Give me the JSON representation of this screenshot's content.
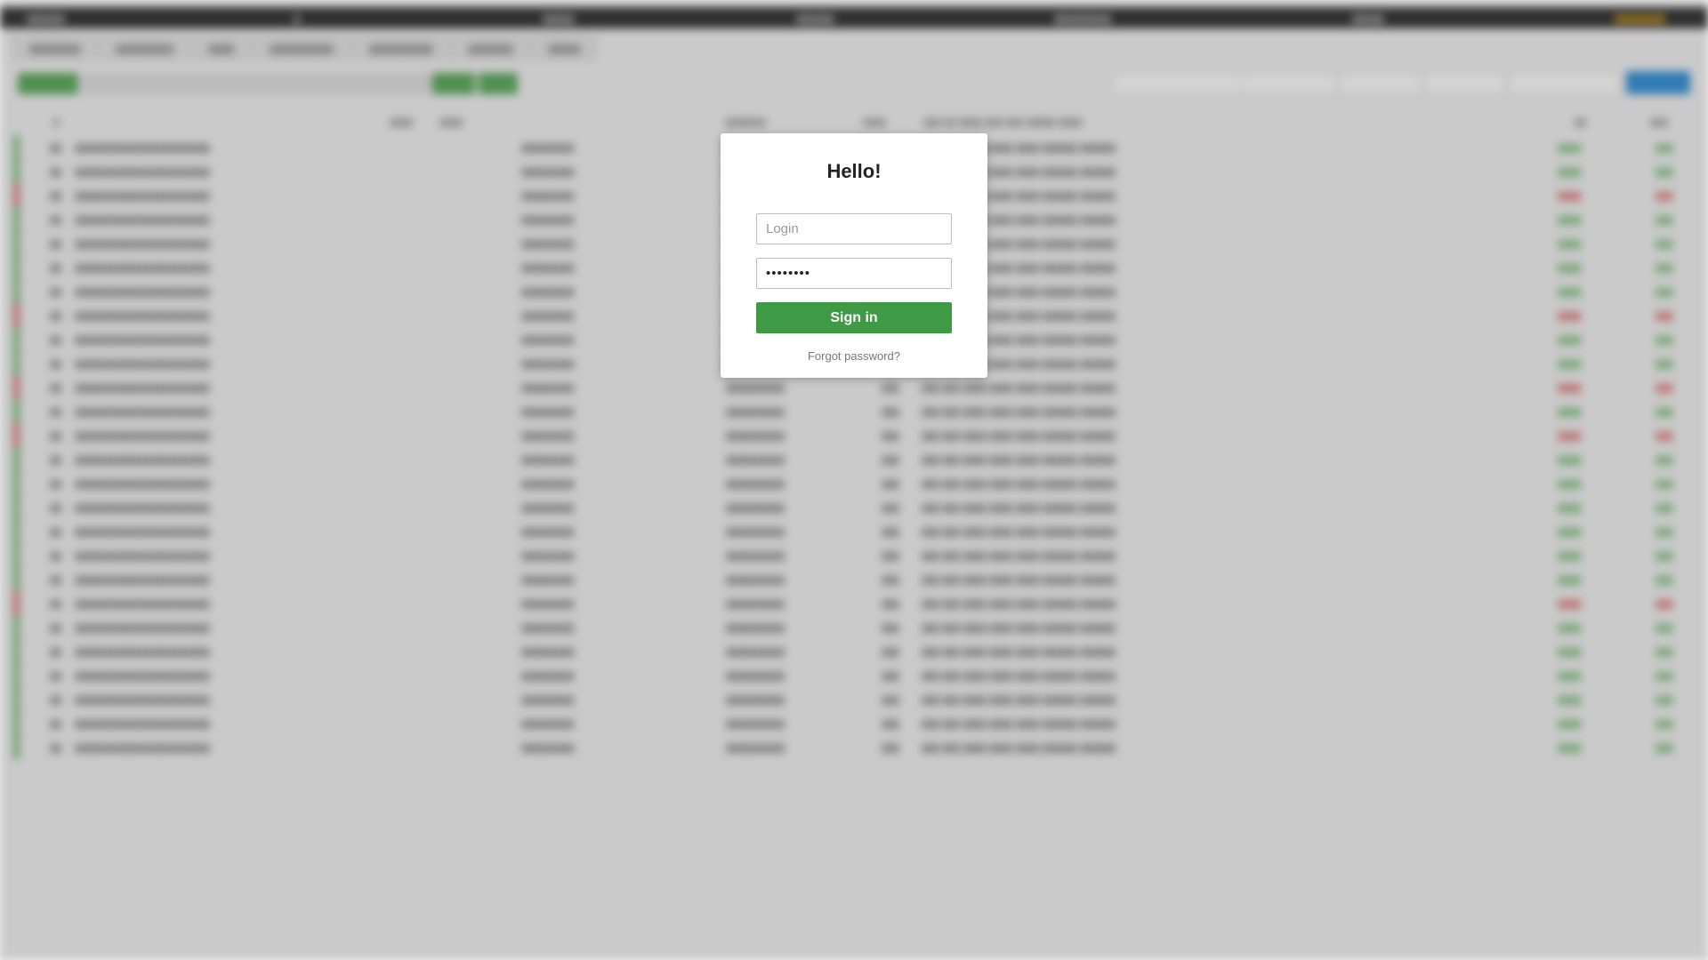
{
  "modal": {
    "title": "Hello!",
    "login_placeholder": "Login",
    "login_value": "",
    "password_value": "••••••••",
    "signin_label": "Sign in",
    "forgot_label": "Forgot password?"
  },
  "colors": {
    "signin_button": "#3f9a45",
    "modal_background": "#ffffff",
    "overlay": "#646464"
  }
}
